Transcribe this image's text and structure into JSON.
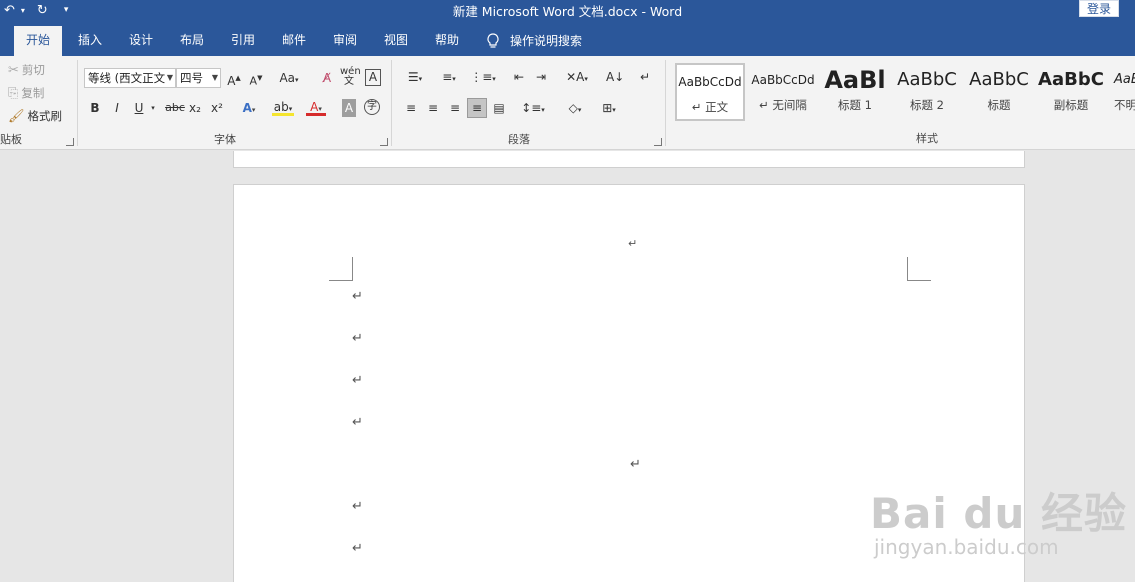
{
  "window": {
    "title": "新建 Microsoft Word 文档.docx  -  Word",
    "login_label": "登录",
    "qat": {
      "undo_icon": "undo-icon",
      "redo_icon": "redo-icon",
      "customize_icon": "customize-qat-icon"
    }
  },
  "tabs": [
    {
      "label": "开始",
      "active": true
    },
    {
      "label": "插入"
    },
    {
      "label": "设计"
    },
    {
      "label": "布局"
    },
    {
      "label": "引用"
    },
    {
      "label": "邮件"
    },
    {
      "label": "审阅"
    },
    {
      "label": "视图"
    },
    {
      "label": "帮助"
    }
  ],
  "tell_me": {
    "label": "操作说明搜索",
    "icon": "lightbulb-icon"
  },
  "clipboard": {
    "cut": "剪切",
    "copy": "复制",
    "format_painter": "格式刷",
    "group_label": "贴板"
  },
  "font": {
    "name": "等线 (西文正文",
    "size": "四号",
    "group_label": "字体",
    "buttons": [
      "B",
      "I",
      "U",
      "abc",
      "x₂",
      "x²"
    ]
  },
  "paragraph": {
    "group_label": "段落"
  },
  "styles": {
    "group_label": "样式",
    "items": [
      {
        "sample": "AaBbCcDd",
        "name": "正文",
        "selected": true
      },
      {
        "sample": "AaBbCcDd",
        "name": "无间隔"
      },
      {
        "sample": "AaBl",
        "name": "标题 1"
      },
      {
        "sample": "AaBbC",
        "name": "标题 2"
      },
      {
        "sample": "AaBbC",
        "name": "标题"
      },
      {
        "sample": "AaBbC",
        "name": "副标题"
      },
      {
        "sample": "AaBl",
        "name": "不明"
      }
    ]
  },
  "document": {
    "paragraph_mark": "↵"
  },
  "watermark": {
    "main": "Bai du 经验",
    "sub": "jingyan.baidu.com"
  }
}
